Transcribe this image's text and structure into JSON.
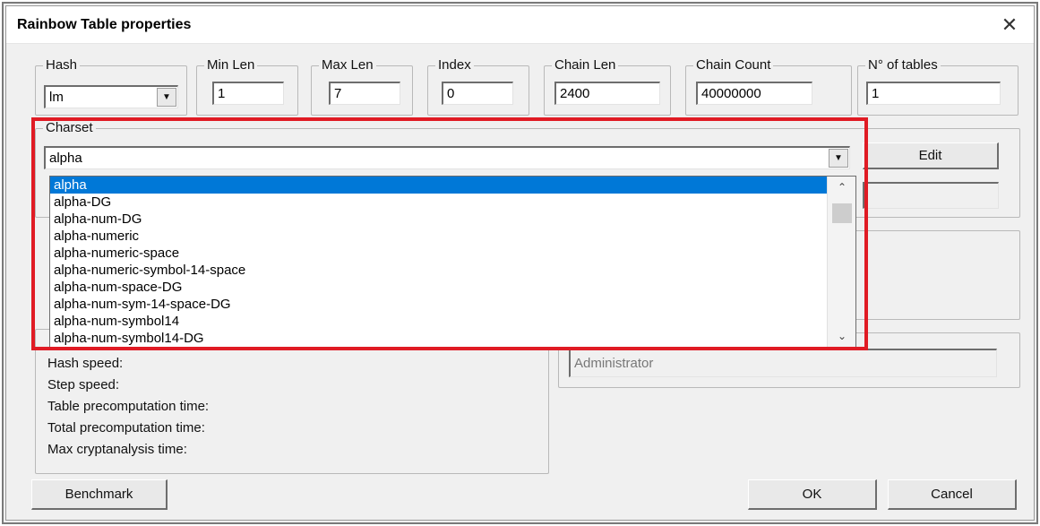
{
  "dialog": {
    "title": "Rainbow Table properties",
    "close_glyph": "✕"
  },
  "params": {
    "hash_label": "Hash",
    "hash_value": "lm",
    "min_len_label": "Min Len",
    "min_len_value": "1",
    "max_len_label": "Max Len",
    "max_len_value": "7",
    "index_label": "Index",
    "index_value": "0",
    "chain_len_label": "Chain Len",
    "chain_len_value": "2400",
    "chain_count_label": "Chain Count",
    "chain_count_value": "40000000",
    "num_tables_label": "N° of tables",
    "num_tables_value": "1"
  },
  "charset": {
    "label": "Charset",
    "selected": "alpha",
    "edit_label": "Edit",
    "options": [
      "alpha",
      "alpha-DG",
      "alpha-num-DG",
      "alpha-numeric",
      "alpha-numeric-space",
      "alpha-numeric-symbol-14-space",
      "alpha-num-space-DG",
      "alpha-num-sym-14-space-DG",
      "alpha-num-symbol14",
      "alpha-num-symbol14-DG"
    ]
  },
  "stats": {
    "hash_speed": "Hash speed:",
    "step_speed": "Step speed:",
    "table_precomputation_time": "Table precomputation time:",
    "total_precomputation_time": "Total precomputation time:",
    "max_cryptanalysis_time": "Max cryptanalysis time:"
  },
  "user": {
    "value": "Administrator"
  },
  "buttons": {
    "benchmark": "Benchmark",
    "ok": "OK",
    "cancel": "Cancel"
  },
  "colors": {
    "highlight": "#e01b24",
    "selection": "#0078d7"
  }
}
